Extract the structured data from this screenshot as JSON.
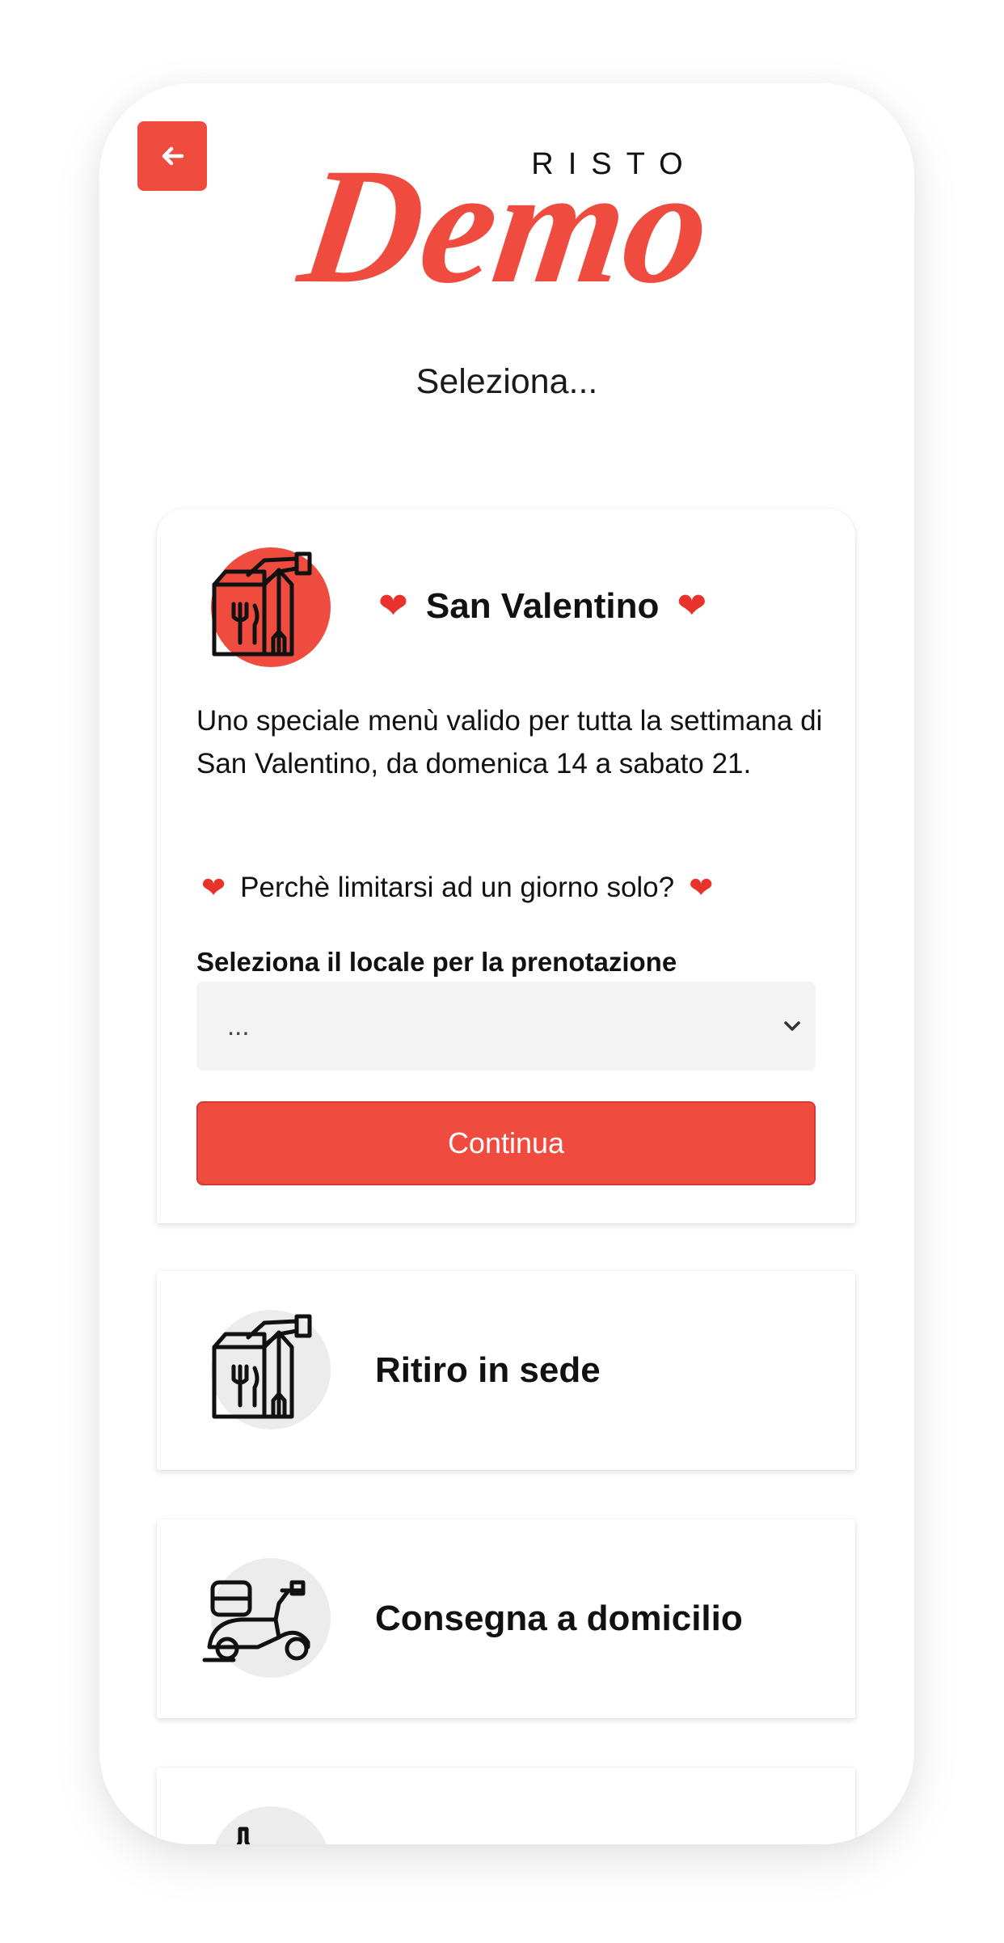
{
  "header": {
    "back_icon": "arrow-left-icon",
    "logo_small_text": "RISTO",
    "logo_script_text": "Demo",
    "brand_color": "#ef4b3f"
  },
  "page": {
    "title": "Seleziona..."
  },
  "featured": {
    "icon": "takeaway-bag-icon",
    "title": "San Valentino",
    "heart_icon": "heart-icon",
    "description": "Uno speciale menù valido per tutta la settimana di San Valentino, da domenica 14 a sabato 21.",
    "tagline": "Perchè limitarsi ad un giorno solo?",
    "select_label": "Seleziona il locale per la prenotazione",
    "select_value": "...",
    "continue_label": "Continua"
  },
  "options": [
    {
      "label": "Ritiro in sede",
      "icon": "takeaway-bag-icon"
    },
    {
      "label": "Consegna a domicilio",
      "icon": "delivery-scooter-icon"
    },
    {
      "label": "",
      "icon": "flask-icon"
    }
  ]
}
